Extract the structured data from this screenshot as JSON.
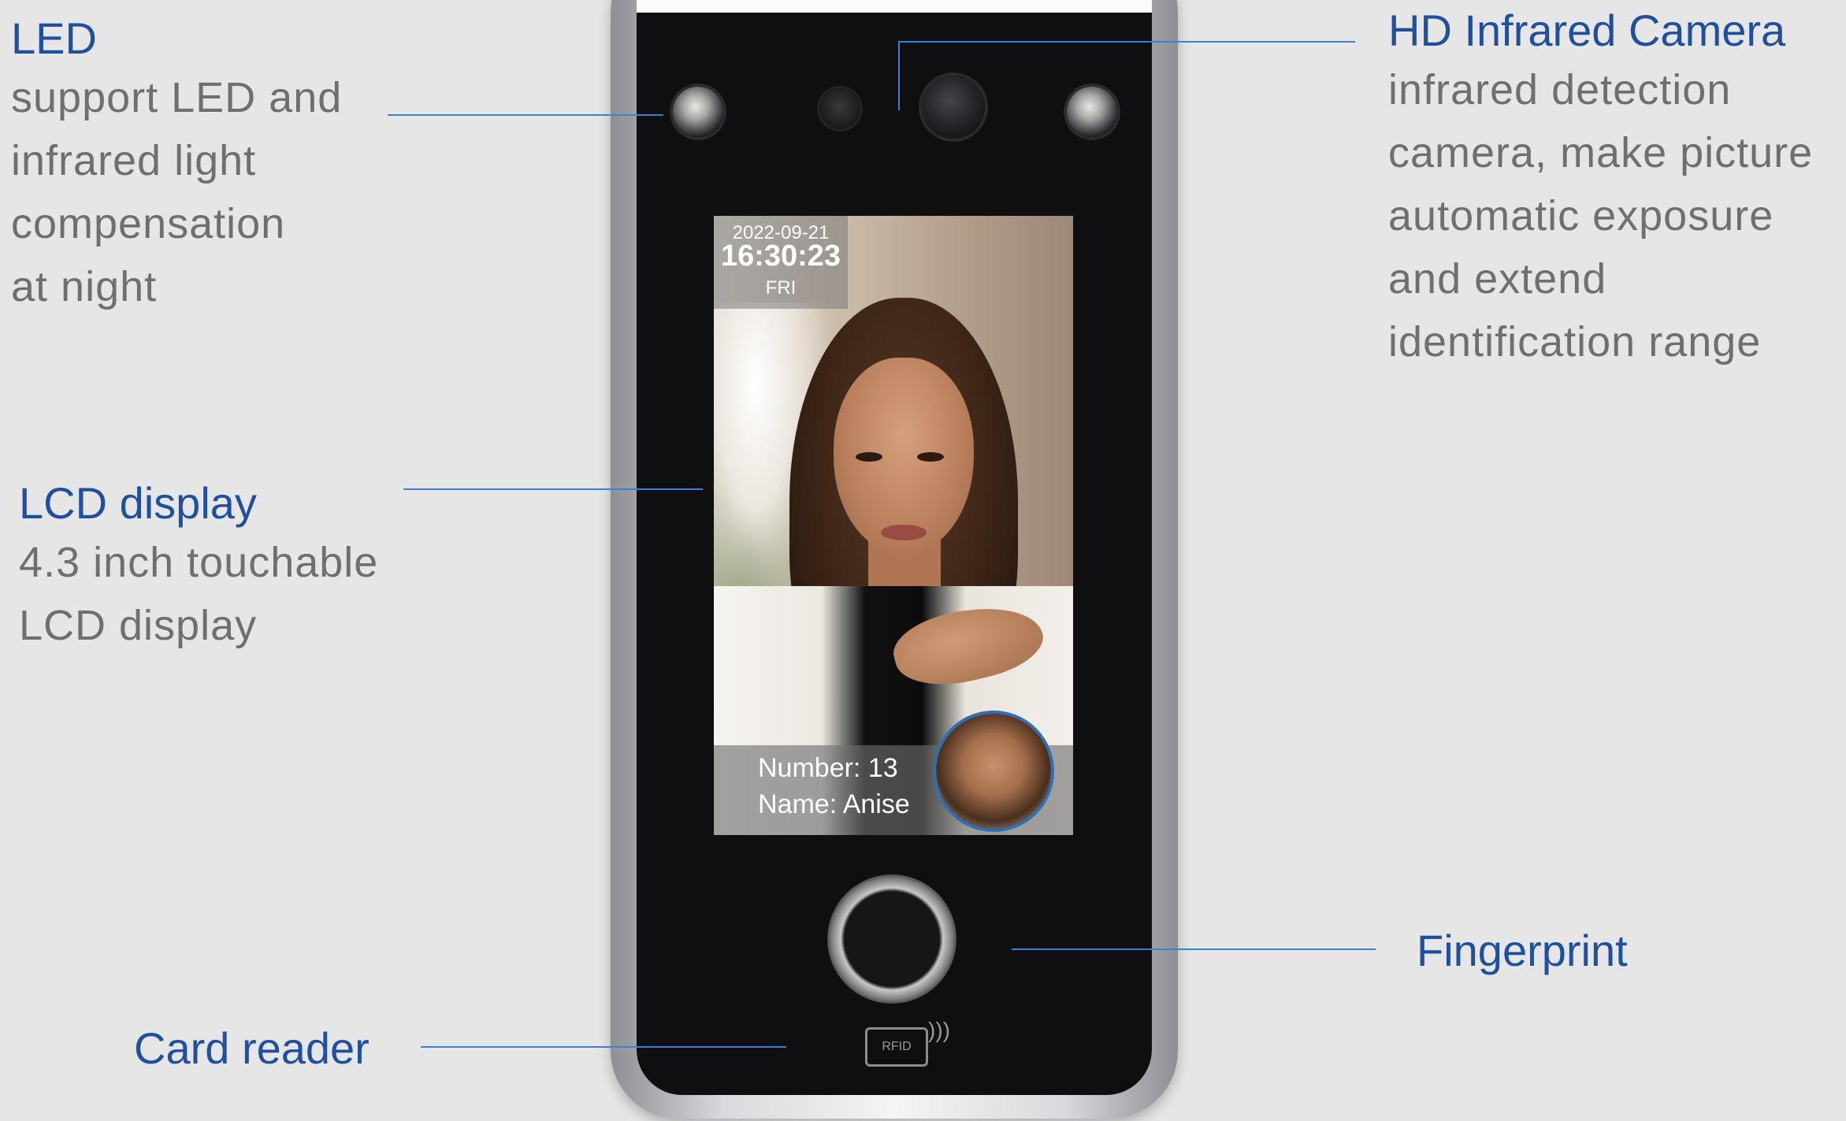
{
  "callouts": {
    "led": {
      "title": "LED",
      "lines": [
        "support LED and",
        "infrared light",
        "compensation",
        "at night"
      ]
    },
    "camera": {
      "title": "HD Infrared Camera",
      "lines": [
        "infrared detection",
        "camera, make picture",
        "automatic exposure",
        "and  extend",
        "identification range"
      ]
    },
    "lcd": {
      "title": "LCD display",
      "lines": [
        "4.3 inch touchable",
        "LCD display"
      ]
    },
    "fingerprint": {
      "title": "Fingerprint"
    },
    "card_reader": {
      "title": "Card reader"
    }
  },
  "screen": {
    "date": "2022-09-21",
    "time": "16:30:23",
    "day": "FRI",
    "number_line": "Number: 13",
    "name_line": "Name: Anise"
  },
  "rfid_label": "RFID",
  "colors": {
    "title_blue": "#1f4f9e",
    "leader_blue": "#3f7fd0",
    "body_gray": "#6f6f6f",
    "background": "#e6e6e6"
  }
}
